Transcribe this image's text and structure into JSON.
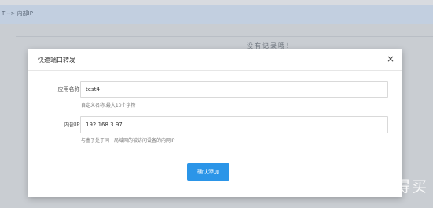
{
  "background": {
    "breadcrumb": "T --> 内部IP",
    "empty_text": "没有记录哦！"
  },
  "modal": {
    "title": "快速端口转发",
    "close_label": "×",
    "fields": {
      "app_name": {
        "label": "应用名称",
        "required_mark": "*",
        "value": "test4",
        "hint": "自定义名称,最大10个字符"
      },
      "internal_ip": {
        "label": "内部IP",
        "required_mark": "*",
        "value": "192.168.3.97",
        "hint": "与盒子处于同一局域网的被访问设备的内网IP"
      }
    },
    "confirm_label": "确认添加"
  },
  "watermark": {
    "text": "新 值 得 买"
  },
  "colors": {
    "accent": "#2b95e8",
    "required": "#e23b3b"
  }
}
